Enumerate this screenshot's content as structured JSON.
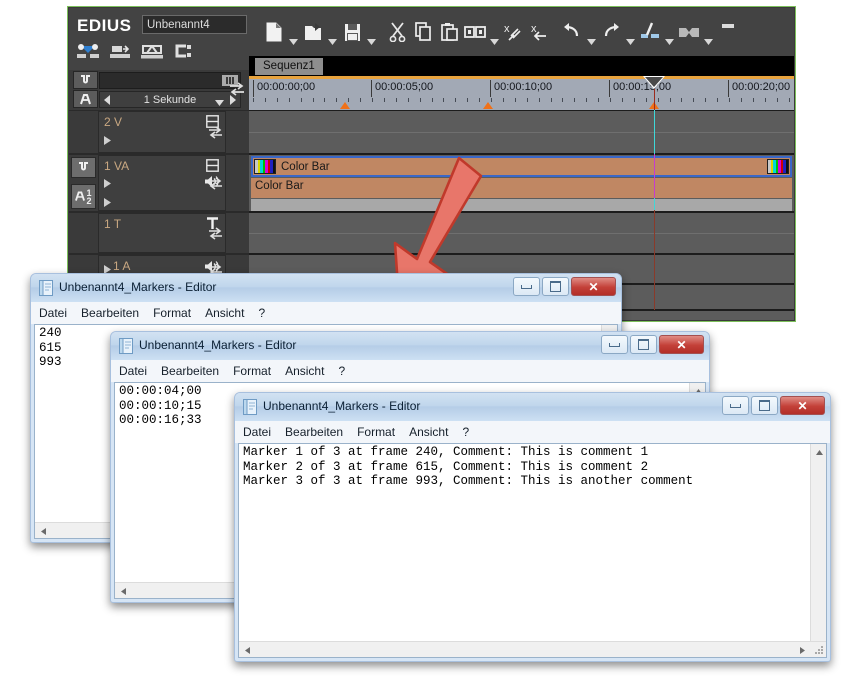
{
  "edius": {
    "logo": "EDIUS",
    "project_name": "Unbenannt4",
    "sequence_tab": "Sequenz1",
    "zoom_scale_label": "1 Sekunde",
    "mini_icons": [
      "add-transition-icon",
      "ripple-icon",
      "link-icon",
      "group-icon"
    ],
    "toolbar_icons": [
      "new-project-icon",
      "open-project-icon",
      "save-project-icon",
      "cut-icon",
      "copy-icon",
      "paste-icon",
      "replace-clip-icon",
      "delete-transition-icon",
      "ripple-delete-icon",
      "undo-icon",
      "redo-icon",
      "add-cut-point-icon",
      "marker-icon"
    ],
    "tracks": [
      {
        "name": "2 V",
        "type": "video",
        "icon": "video-track-icon"
      },
      {
        "name": "1 VA",
        "type": "videoaudio",
        "icon": "video-track-icon",
        "audio_icon": "speaker-icon"
      },
      {
        "name": "1 T",
        "type": "title",
        "icon": "title-T-icon"
      },
      {
        "name": "1 A",
        "type": "audio",
        "icon": "speaker-icon"
      }
    ],
    "timeline": {
      "ruler_labels": [
        "00:00:00;00",
        "00:00:05;00",
        "00:00:10;00",
        "00:00:15;00",
        "00:00:20;00"
      ],
      "playhead_timecode": "00:00:15;00",
      "markers_seconds": [
        4,
        10,
        16
      ],
      "clips": [
        {
          "label": "Color Bar",
          "track": "1 VA video",
          "thumbnail": "color-bar-icon"
        },
        {
          "label": "Color Bar",
          "track": "1 VA audio"
        }
      ]
    }
  },
  "notepad_windows": [
    {
      "title": "Unbenannt4_Markers - Editor",
      "icon": "notepad-icon",
      "menu": [
        "Datei",
        "Bearbeiten",
        "Format",
        "Ansicht",
        "?"
      ],
      "content": "240\n615\n993",
      "controls": {
        "minimize": "minimize-button",
        "maximize": "maximize-button",
        "close": "close-button"
      }
    },
    {
      "title": "Unbenannt4_Markers - Editor",
      "icon": "notepad-icon",
      "menu": [
        "Datei",
        "Bearbeiten",
        "Format",
        "Ansicht",
        "?"
      ],
      "content": "00:00:04;00\n00:00:10;15\n00:00:16;33",
      "controls": {
        "minimize": "minimize-button",
        "maximize": "maximize-button",
        "close": "close-button"
      }
    },
    {
      "title": "Unbenannt4_Markers - Editor",
      "icon": "notepad-icon",
      "menu": [
        "Datei",
        "Bearbeiten",
        "Format",
        "Ansicht",
        "?"
      ],
      "content": "Marker 1 of 3 at frame 240, Comment: This is comment 1\nMarker 2 of 3 at frame 615, Comment: This is comment 2\nMarker 3 of 3 at frame 993, Comment: This is another comment",
      "controls": {
        "minimize": "minimize-button",
        "maximize": "maximize-button",
        "close": "close-button"
      }
    }
  ],
  "annotation": {
    "arrow": "red-arrow-pointing-down-left"
  },
  "colors": {
    "edius_border": "#7cbf5a",
    "clip_fill": "#c08763",
    "clip_border": "#3a67c8",
    "marker_orange": "#f07118",
    "ruler_bg": "#a2a9b5",
    "ruler_accent": "#e8a33d",
    "playhead_cyan": "#3fd8d8",
    "playhead_magenta": "#c63bd0",
    "arrow_fill": "#e8766a",
    "arrow_stroke": "#c0392b",
    "close_button": "#c34038",
    "track_name": "#c9a882"
  }
}
